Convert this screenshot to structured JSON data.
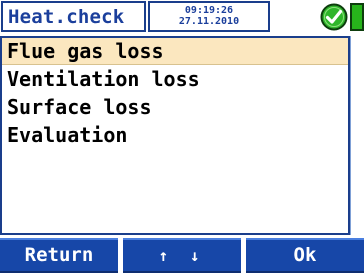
{
  "header": {
    "title": "Heat.check",
    "time": "09:19:26",
    "date": "27.11.2010",
    "status_icon": "check-circle-icon",
    "status_color": "#27b41b"
  },
  "menu": {
    "items": [
      {
        "label": "Flue gas loss",
        "selected": true
      },
      {
        "label": "Ventilation loss",
        "selected": false
      },
      {
        "label": "Surface loss",
        "selected": false
      },
      {
        "label": "Evaluation",
        "selected": false
      }
    ]
  },
  "softkeys": {
    "left": "Return",
    "middle": "↑ ↓",
    "right": "Ok"
  },
  "colors": {
    "accent": "#1747a8",
    "selection": "#fbe7bf",
    "text": "#000000"
  }
}
